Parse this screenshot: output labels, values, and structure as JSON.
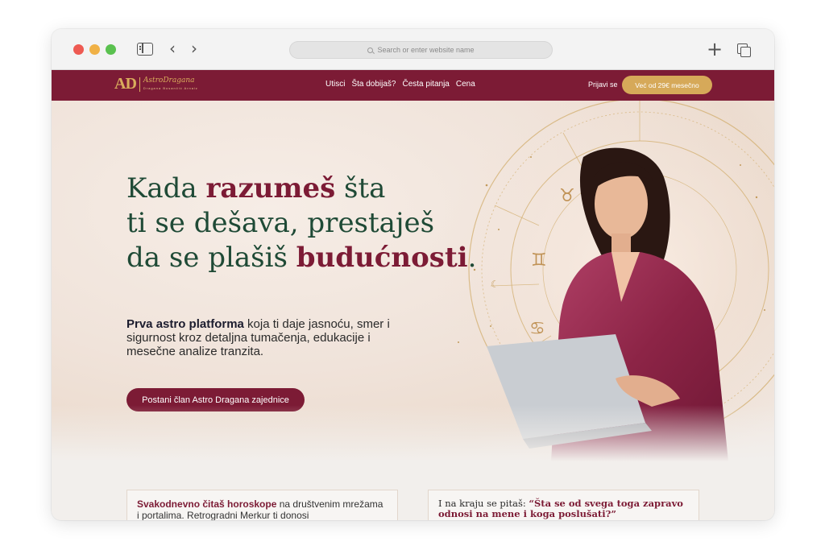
{
  "browser": {
    "url_placeholder": "Search or enter website name",
    "back_glyph": "‹",
    "forward_glyph": "›",
    "new_tab_glyph": "+"
  },
  "nav": {
    "logo_mark": "AD",
    "logo_script": "AstroDragana",
    "logo_sub": "Dragana Bosančić Arnaiz",
    "menu": [
      "Utisci",
      "Šta dobijaš?",
      "Česta pitanja",
      "Cena"
    ],
    "login": "Prijavi se",
    "cta": "Već od 29€ mesečno"
  },
  "hero": {
    "title": {
      "l1a": "Kada ",
      "l1b": "razumeš",
      "l1c": " šta",
      "l2": "ti se dešava, prestaješ",
      "l3a": "da se plašiš ",
      "l3b": "budućnosti",
      "l3c": "."
    },
    "sub_bold": "Prva astro platforma",
    "sub_rest": " koja ti daje jasnoću, smer i sigurnost kroz detaljna tumačenja, edukacije i mesečne analize tranzita.",
    "cta": "Postani član Astro Dragana zajednice",
    "zodiac_symbols": [
      "♈",
      "♉",
      "♊",
      "♋",
      "☾"
    ]
  },
  "cards": {
    "left_bold": "Svakodnevno čitaš horoskope",
    "left_rest": " na društvenim mrežama i portalima. Retrogradni Merkur ti donosi",
    "right_pre": "I na kraju se pitaš: ",
    "right_quote_a": "“Šta se od svega ",
    "right_quote_b": "toga",
    "right_quote_c": " zapravo odnosi na mene i koga poslušati?”"
  },
  "colors": {
    "brand_burgundy": "#7c1b35",
    "brand_gold": "#d6a959",
    "title_green": "#1f4a36"
  }
}
